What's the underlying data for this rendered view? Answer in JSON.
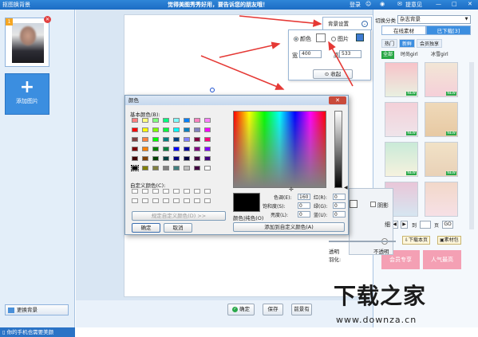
{
  "titlebar": {
    "title": "抠图换背景",
    "slogan": "觉得美图秀秀好用，要告诉您的朋友哦！",
    "login": "登录",
    "feedback": "提意见"
  },
  "left": {
    "thumb_badge": "1",
    "add_label": "添加图片",
    "change_bg": "更换背景",
    "status": "你的手机也需要美颜"
  },
  "bg_settings": {
    "tab_label": "背景设置",
    "color_label": "颜色",
    "image_label": "图片",
    "width_label": "宽",
    "width_value": "400",
    "height_label": "高",
    "height_value": "533",
    "collapse_label": "收起"
  },
  "right": {
    "category_label": "切换分类",
    "category_value": "杂志背景",
    "tab_online": "在线素材",
    "tab_downloaded": "已下载[3]",
    "subtabs": [
      "热门",
      "新鲜",
      "会员独享"
    ],
    "filters": [
      "全部",
      "时尚girl",
      "冰雪girl"
    ],
    "tile_badge": "NEW",
    "pager_to": "到",
    "pager_page": "页",
    "pager_go": "GO",
    "download_page": "下载本页",
    "library": "素材包",
    "promo": [
      "会员专享",
      "人气最高"
    ]
  },
  "adjust": {
    "effect_label": "阴影",
    "opacity_label": "透明",
    "feather_label": "羽化:",
    "opaque_label": "不透明",
    "thin_label": "细"
  },
  "bottom": {
    "ok": "确定",
    "save": "保存",
    "switch": "前景有"
  },
  "color_dialog": {
    "title": "颜色",
    "basic_colors": "基本颜色(B):",
    "custom_colors": "自定义颜色(C):",
    "define_custom": "规定自定义颜色(D) >>",
    "ok": "确定",
    "cancel": "取消",
    "color_solid": "颜色|纯色(O)",
    "hue_label": "色调(E):",
    "hue": "160",
    "sat_label": "饱和度(S):",
    "sat": "0",
    "lum_label": "亮度(L):",
    "lum": "0",
    "red_label": "红(R):",
    "red": "0",
    "green_label": "绿(G):",
    "green": "0",
    "blue_label": "蓝(U):",
    "blue": "0",
    "add_custom": "添加到自定义颜色(A)",
    "basic_palette": [
      [
        "#ff8080",
        "#ffff80",
        "#80ff80",
        "#00ff80",
        "#80ffff",
        "#0080ff",
        "#ff80c0",
        "#ff80ff"
      ],
      [
        "#ff0000",
        "#ffff00",
        "#80ff00",
        "#00ff40",
        "#00ffff",
        "#0080c0",
        "#8080c0",
        "#ff00ff"
      ],
      [
        "#804040",
        "#ff8040",
        "#00ff00",
        "#008080",
        "#004080",
        "#8080ff",
        "#800040",
        "#ff0080"
      ],
      [
        "#800000",
        "#ff8000",
        "#008000",
        "#008040",
        "#0000ff",
        "#0000a0",
        "#800080",
        "#8000ff"
      ],
      [
        "#400000",
        "#804000",
        "#004000",
        "#004040",
        "#000080",
        "#000040",
        "#400040",
        "#400080"
      ],
      [
        "#000000",
        "#808000",
        "#808040",
        "#808080",
        "#408080",
        "#c0c0c0",
        "#400040",
        "#ffffff"
      ]
    ]
  },
  "watermark": {
    "logo": "下载之家",
    "url": "www.downza.cn"
  }
}
